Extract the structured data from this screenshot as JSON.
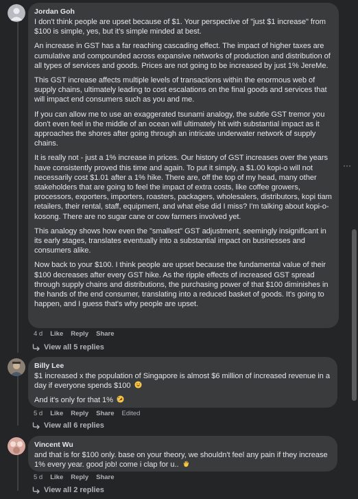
{
  "comments": [
    {
      "author": "Jordan Goh",
      "paragraphs": [
        "I don't think people are upset because of $1. Your perspective of \"just $1 increase\" from $100 is simple, yes, but it's simple minded at best.",
        "An increase in GST has a far reaching cascading effect. The impact of higher taxes are cumulative and compounded across expansive networks of production and distribution of all types of services and goods. Prices are not going to be increased by just 1% JereMe.",
        "This GST increase affects multiple levels of transactions within the enormous web of supply chains, ultimately leading to cost escalations on the final goods and services that will impact end consumers such as you and me.",
        "If you can allow me to use an exaggerated tsunami analogy, the subtle GST tremor you don't even feel in the middle of an ocean will ultimately hit with substantial impact as it approaches the shores after going through an intricate underwater network of supply chains.",
        "It is really not - just a 1% increase in prices. Our history of GST increases over the years have consistently proved this time and again. To put it simply, a $1.00 kopi-o will not necessarily cost $1.01 after a 1% hike. There are, off the top of my head, many other stakeholders that are going to feel the impact of extra costs, like coffee growers, processors, exporters, importers, roasters, packagers, wholesalers, distributors, kopi tiam retailers, their rental, staff, equipment, and what else did I miss? I'm talking about kopi-o-kosong. There are no sugar cane or cow farmers involved yet.",
        "This analogy shows how even the \"smallest\" GST adjustment, seemingly insignificant in its early stages, translates eventually into a substantial impact on businesses and consumers alike.",
        "Now back to your $100. I think people are upset because the fundamental value of their $100 decreases after every GST hike. As the ripple effects of increased GST spread through supply chains and distributions, the purchasing power of that $100 diminishes in the hands of the end consumer, translating into a reduced basket of goods. It's going to happen, and I guess that's why people are upset."
      ],
      "time": "4 d",
      "like": "Like",
      "reply": "Reply",
      "share": "Share",
      "edited": "",
      "view_replies": "View all 5 replies"
    },
    {
      "author": "Billy Lee",
      "paragraphs": [
        "$1 increased x the population of Singapore is almost $6 million of increased revenue in a day if everyone spends $100",
        "And it's only for that 1%"
      ],
      "time": "5 d",
      "like": "Like",
      "reply": "Reply",
      "share": "Share",
      "edited": "Edited",
      "view_replies": "View all 6 replies"
    },
    {
      "author": "Vincent Wu",
      "paragraphs": [
        "and that is for $100 only. base on your theory, we shouldn't feel any pain if they increase 1% every year. good job! come i clap for u.."
      ],
      "time": "5 d",
      "like": "Like",
      "reply": "Reply",
      "share": "Share",
      "edited": "",
      "view_replies": "View all 2 replies"
    }
  ],
  "more_options": "···",
  "colors": {
    "background": "#242526",
    "bubble": "#3a3b3c",
    "text": "#e4e6eb",
    "secondary_text": "#b0b3b8"
  },
  "icons": [
    "avatar",
    "reply-arrow-icon",
    "grinning-sweat-emoji-icon",
    "rofl-emoji-icon",
    "clap-emoji-icon",
    "more-options-icon"
  ]
}
